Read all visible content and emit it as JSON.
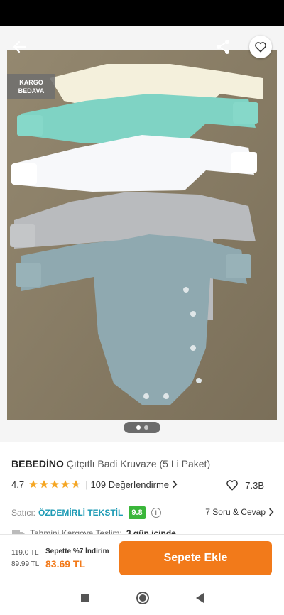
{
  "top_bar": {
    "back_icon": "arrow-left-icon",
    "share_icon": "share-icon",
    "favorite_icon": "heart-outline-icon"
  },
  "badge": {
    "line1": "KARGO",
    "line2": "BEDAVA"
  },
  "gallery": {
    "page_count": 2,
    "current_page": 1
  },
  "product": {
    "brand": "BEBEDİNO",
    "name": "Çıtçıtlı Badi Kruvaze (5 Li Paket)",
    "rating": "4.7",
    "rating_value": 4.7,
    "review_count": "109 Değerlendirme",
    "likes": "7.3B",
    "bodysuit_colors": [
      "#f4f0dc",
      "#7fd3c4",
      "#f7f8fa",
      "#b9bbbe",
      "#8fa9b0"
    ]
  },
  "seller": {
    "label": "Satıcı:",
    "name": "ÖZDEMİRLİ TEKSTİL",
    "score": "9.8",
    "qa_link": "7 Soru & Cevap"
  },
  "delivery": {
    "label": "Tahmini Kargoya Teslim:",
    "value": "3 gün içinde"
  },
  "purchase": {
    "old_price": "119.0 TL",
    "base_price": "89.99 TL",
    "promo": "Sepette %7 İndirim",
    "final_price": "83.69 TL",
    "cart_button": "Sepete Ekle"
  },
  "colors": {
    "accent": "#f27a1a",
    "seller_link": "#1e9bb5",
    "score_badge": "#3ab63a",
    "star": "#f5a623"
  }
}
